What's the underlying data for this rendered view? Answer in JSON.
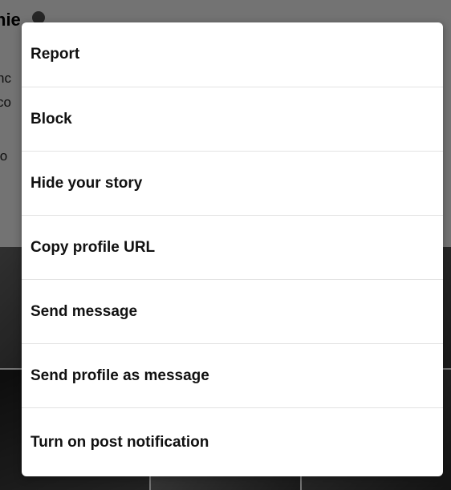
{
  "background": {
    "header_text": "nie",
    "side_texts": [
      "nc",
      "co",
      "jo"
    ]
  },
  "action_sheet": {
    "items": [
      {
        "id": "report",
        "label": "Report"
      },
      {
        "id": "block",
        "label": "Block"
      },
      {
        "id": "hide-story",
        "label": "Hide your story"
      },
      {
        "id": "copy-profile-url",
        "label": "Copy profile URL"
      },
      {
        "id": "send-message",
        "label": "Send message"
      },
      {
        "id": "send-profile",
        "label": "Send profile as message"
      },
      {
        "id": "post-notification",
        "label": "Turn on post notification"
      }
    ]
  },
  "colors": {
    "overlay": "#000000",
    "dialog_background": "#ffffff",
    "divider": "#e3e3e3",
    "text": "#111111"
  }
}
